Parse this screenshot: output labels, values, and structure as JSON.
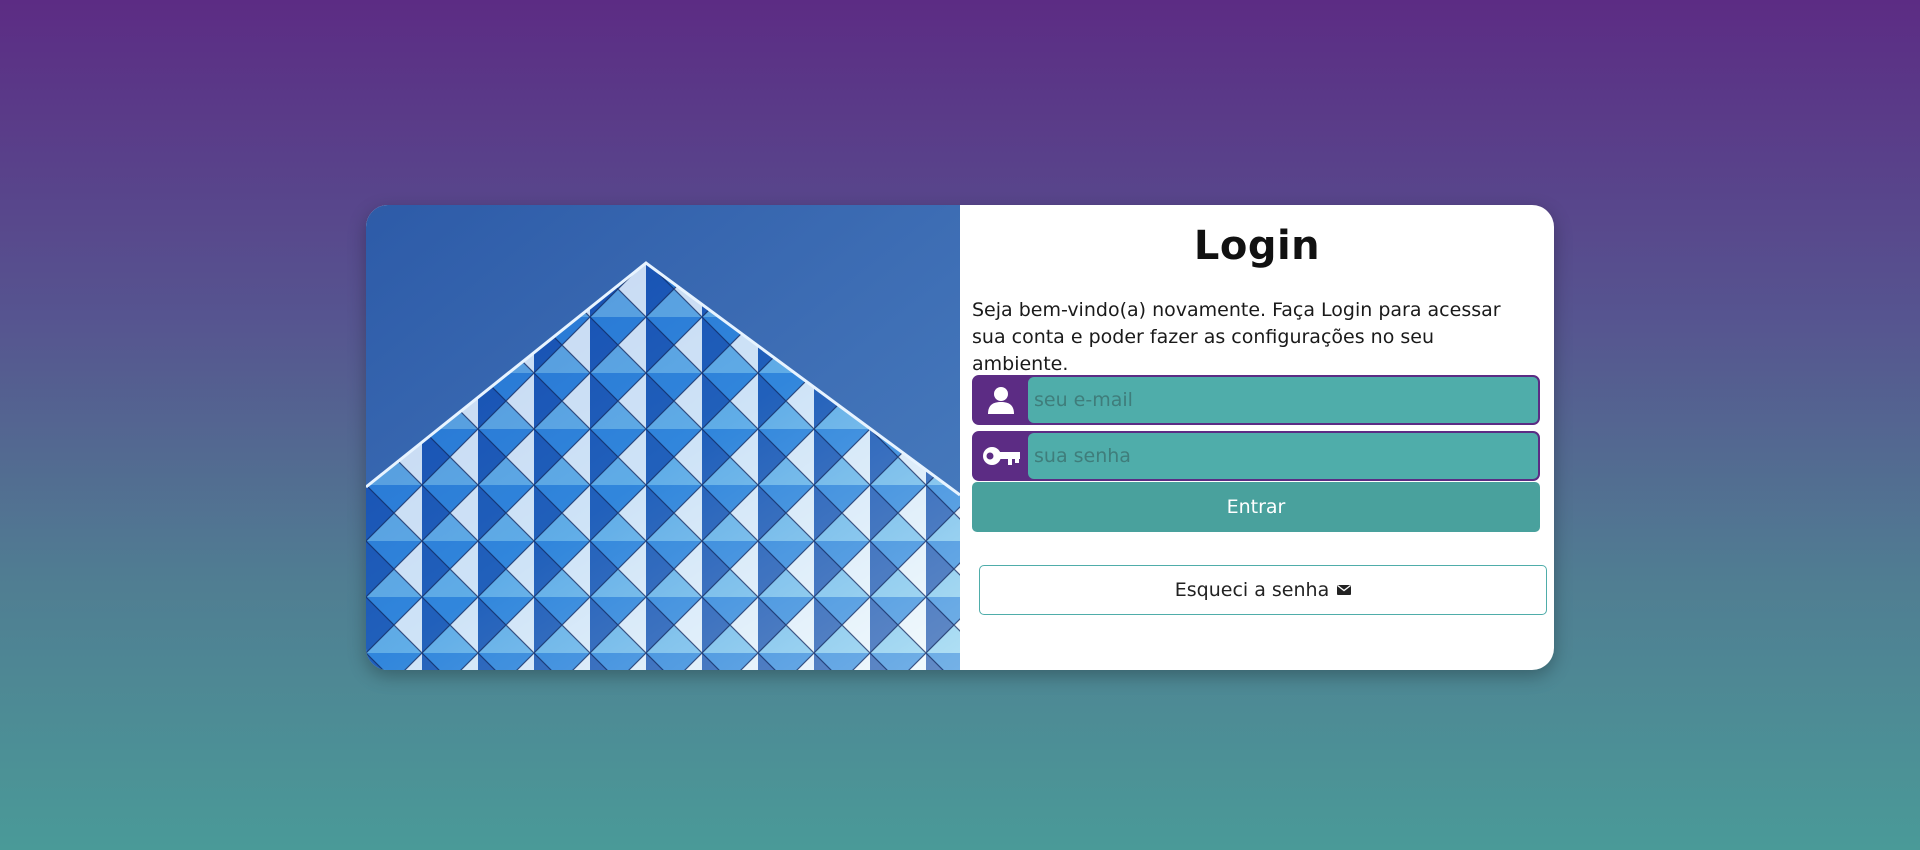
{
  "login": {
    "title": "Login",
    "intro": "Seja bem-vindo(a) novamente. Faça Login para acessar sua conta e poder fazer as configurações no seu ambiente.",
    "email": {
      "placeholder": "seu e-mail",
      "value": "",
      "icon": "user-icon"
    },
    "password": {
      "placeholder": "sua senha",
      "value": "",
      "icon": "key-icon"
    },
    "submit_label": "Entrar",
    "forgot_label": "Esqueci a senha",
    "forgot_icon": "envelope-icon"
  },
  "colors": {
    "primary": "#5c2c84",
    "accent": "#4fadaa",
    "button": "#49a19d",
    "background_top": "#5c2c84",
    "background_bottom": "#4a9a98"
  },
  "image": {
    "subject": "building-facade-photo"
  }
}
